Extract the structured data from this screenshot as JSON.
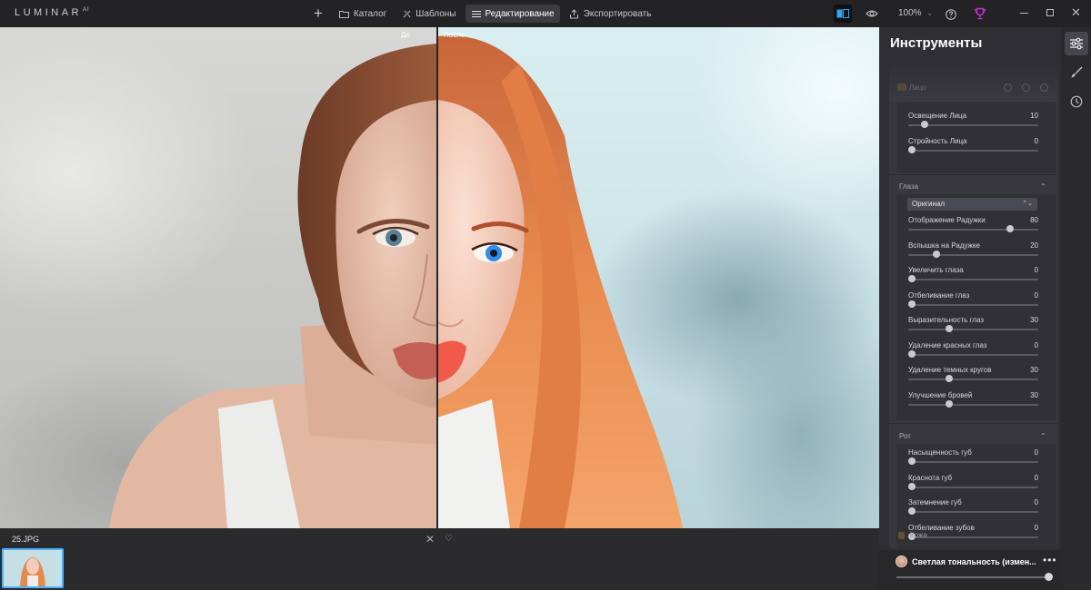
{
  "app": {
    "logo": "LUMINAR",
    "logo_suffix": "AI"
  },
  "nav": {
    "add_label": "+",
    "items": [
      {
        "label": "Каталог",
        "icon": "folder-icon",
        "active": false
      },
      {
        "label": "Шаблоны",
        "icon": "templates-icon",
        "active": false
      },
      {
        "label": "Редактирование",
        "icon": "sliders-icon",
        "active": true
      },
      {
        "label": "Экспортировать",
        "icon": "export-icon",
        "active": false
      }
    ]
  },
  "view": {
    "zoom": "100%",
    "zoom_caret": "⌄",
    "before_label": "До",
    "after_label": "После"
  },
  "filmstrip": {
    "filename": "25.JPG",
    "close": "✕",
    "heart": "♡"
  },
  "panel": {
    "title": "Инструменты",
    "faded_section": "Лицо",
    "sections": [
      {
        "id": "face",
        "title": "",
        "sliders": [
          {
            "label": "Освещение Лица",
            "value": "10",
            "fraction": 0.1
          },
          {
            "label": "Стройность Лица",
            "value": "0",
            "fraction": 0.0
          }
        ]
      },
      {
        "id": "eyes",
        "title": "Глаза",
        "dropdown": "Оригинал",
        "sliders": [
          {
            "label": "Отображение Радужки",
            "value": "80",
            "fraction": 0.8
          },
          {
            "label": "Вспышка на Радужке",
            "value": "20",
            "fraction": 0.2
          },
          {
            "label": "Увеличить глаза",
            "value": "0",
            "fraction": 0.0
          },
          {
            "label": "Отбеливание глаз",
            "value": "0",
            "fraction": 0.0
          },
          {
            "label": "Выразительность глаз",
            "value": "30",
            "fraction": 0.3
          },
          {
            "label": "Удаление красных глаз",
            "value": "0",
            "fraction": 0.0
          },
          {
            "label": "Удаление темных кругов",
            "value": "30",
            "fraction": 0.3
          },
          {
            "label": "Улучшение бровей",
            "value": "30",
            "fraction": 0.3
          }
        ]
      },
      {
        "id": "mouth",
        "title": "Рот",
        "sliders": [
          {
            "label": "Насыщенность губ",
            "value": "0",
            "fraction": 0.0
          },
          {
            "label": "Краснота губ",
            "value": "0",
            "fraction": 0.0
          },
          {
            "label": "Затемнение губ",
            "value": "0",
            "fraction": 0.0
          },
          {
            "label": "Отбеливание зубов",
            "value": "0",
            "fraction": 0.0
          }
        ]
      }
    ],
    "next_section": "Кожа",
    "preset_name": "Светлая тональность (измен...",
    "preset_more": "•••",
    "preset_amount": 1.0,
    "chevron": "⌃",
    "dropdown_arrows": "⌃⌄"
  },
  "colors": {
    "accent": "#4ab3ff",
    "active_nav": "#3c3c40",
    "trophy": "#c72fd6",
    "compare": "#2ea3ff"
  }
}
